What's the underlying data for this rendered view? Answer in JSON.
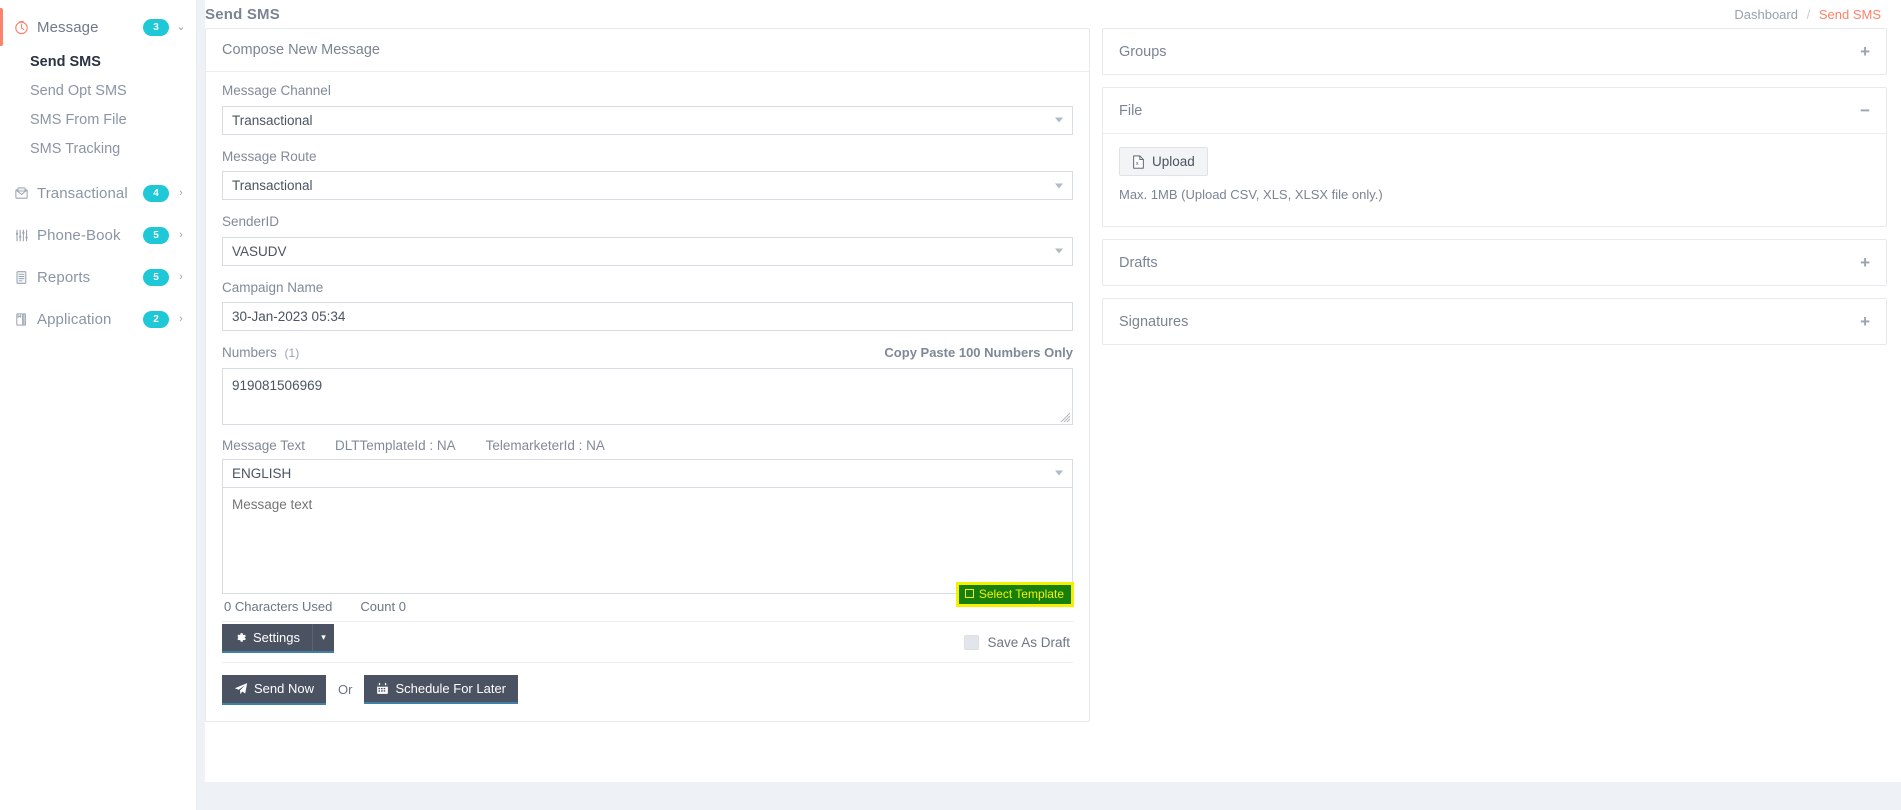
{
  "sidebar": {
    "groups": [
      {
        "label": "Message",
        "icon": "clock-icon",
        "badge": "3",
        "caret": "⌄",
        "active": true,
        "children": [
          {
            "label": "Send SMS",
            "selected": true
          },
          {
            "label": "Send Opt SMS",
            "selected": false
          },
          {
            "label": "SMS From File",
            "selected": false
          },
          {
            "label": "SMS Tracking",
            "selected": false
          }
        ]
      },
      {
        "label": "Transactional",
        "icon": "envelope-icon",
        "badge": "4",
        "caret": "›",
        "active": false,
        "children": []
      },
      {
        "label": "Phone-Book",
        "icon": "sliders-icon",
        "badge": "5",
        "caret": "›",
        "active": false,
        "children": []
      },
      {
        "label": "Reports",
        "icon": "document-icon",
        "badge": "5",
        "caret": "›",
        "active": false,
        "children": []
      },
      {
        "label": "Application",
        "icon": "book-icon",
        "badge": "2",
        "caret": "›",
        "active": false,
        "children": []
      }
    ]
  },
  "header": {
    "title": "Send SMS",
    "breadcrumb": {
      "root": "Dashboard",
      "separator": "/",
      "current": "Send SMS"
    }
  },
  "compose": {
    "card_title": "Compose New Message",
    "message_channel": {
      "label": "Message Channel",
      "value": "Transactional"
    },
    "message_route": {
      "label": "Message Route",
      "value": "Transactional"
    },
    "sender_id": {
      "label": "SenderID",
      "value": "VASUDV"
    },
    "campaign_name": {
      "label": "Campaign Name",
      "value": "30-Jan-2023 05:34"
    },
    "numbers": {
      "label": "Numbers",
      "count_note": "(1)",
      "right_note": "Copy Paste 100 Numbers Only",
      "value": "919081506969"
    },
    "message_text": {
      "label": "Message Text",
      "dlt_template": "DLTTemplateId : NA",
      "telemarketer": "TelemarketerId : NA",
      "language": "ENGLISH",
      "placeholder": "Message text",
      "value": ""
    },
    "counters": {
      "characters": "0 Characters Used",
      "count": "Count 0"
    },
    "select_template_label": "Select Template",
    "save_as_draft_label": "Save As Draft",
    "settings_label": "Settings",
    "settings_caret": "▾",
    "send_now_label": "Send Now",
    "or_label": "Or",
    "schedule_label": "Schedule For Later"
  },
  "right_panels": [
    {
      "title": "Groups",
      "toggle": "+",
      "expanded": false
    },
    {
      "title": "File",
      "toggle": "−",
      "expanded": true,
      "upload_label": "Upload",
      "upload_note": "Max. 1MB (Upload CSV, XLS, XLSX file only.)"
    },
    {
      "title": "Drafts",
      "toggle": "+",
      "expanded": false
    },
    {
      "title": "Signatures",
      "toggle": "+",
      "expanded": false
    }
  ],
  "colors": {
    "accent_coral": "#f9836b",
    "badge_cyan": "#1ec8d6",
    "button_dark": "#4b5262",
    "button_underline": "#3f7fa8",
    "highlight_yellow": "#f5f000",
    "highlight_green": "#17800d",
    "page_bg": "#eef1f5"
  }
}
